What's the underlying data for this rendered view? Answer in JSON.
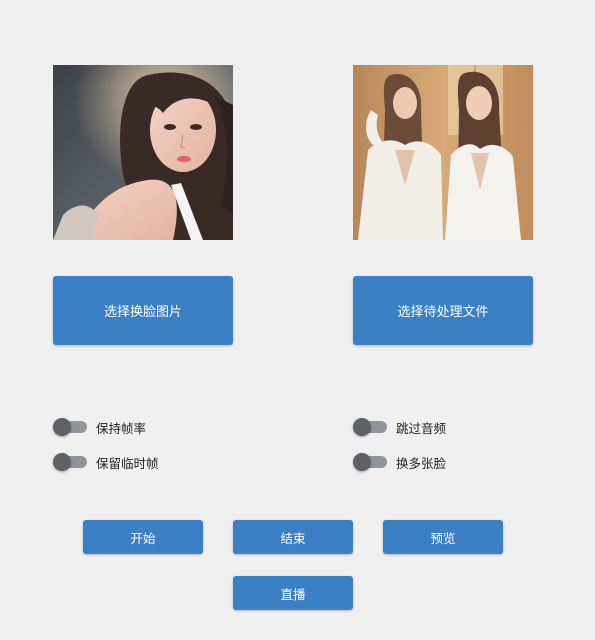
{
  "images": {
    "source_face": "source-face-photo",
    "target_media": "target-media-photo"
  },
  "buttons": {
    "select_face": "选择换脸图片",
    "select_target": "选择待处理文件",
    "start": "开始",
    "stop": "结束",
    "preview": "预览",
    "live": "直播"
  },
  "toggles": {
    "keep_fps": {
      "label": "保持帧率",
      "on": false
    },
    "keep_temp": {
      "label": "保留临时帧",
      "on": false
    },
    "skip_audio": {
      "label": "跳过音频",
      "on": false
    },
    "many_faces": {
      "label": "换多张脸",
      "on": false
    }
  },
  "colors": {
    "background": "#f0f0f0",
    "button": "#3b7fc4",
    "button_text": "#ffffff",
    "switch_track": "#8f959b",
    "switch_thumb": "#5e6266"
  }
}
